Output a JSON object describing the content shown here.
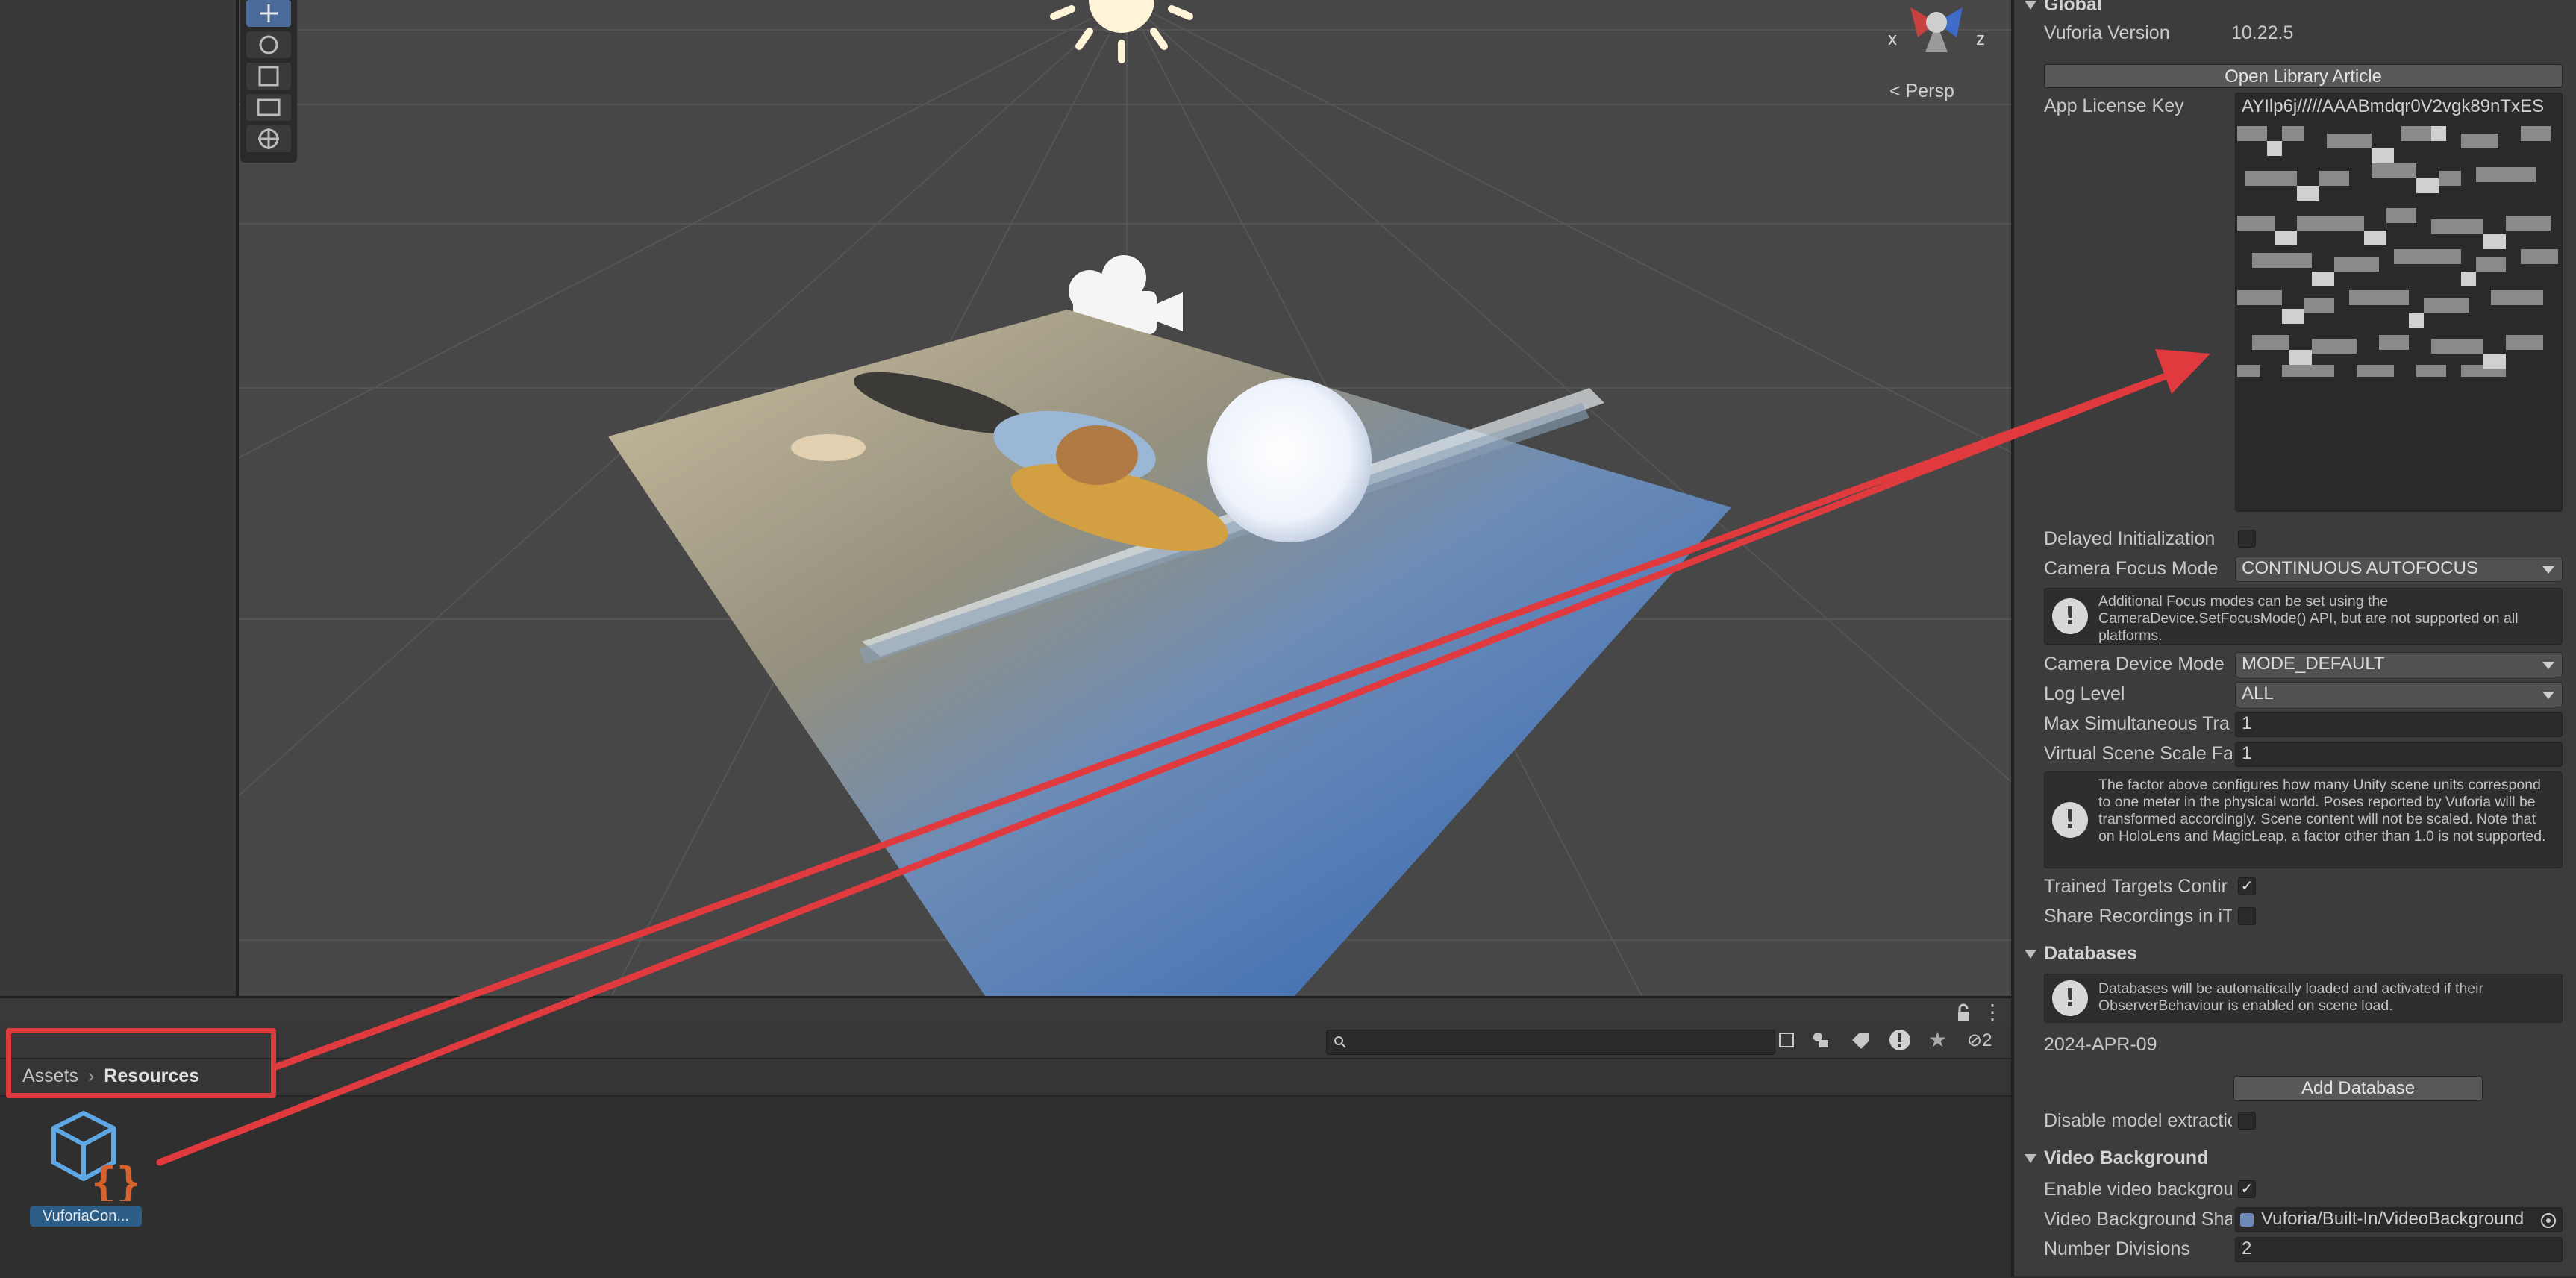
{
  "scene": {
    "gizmo_x": "x",
    "gizmo_z": "z",
    "persp_label": "Persp",
    "tools": [
      "move-tool-icon",
      "rotate-tool-icon",
      "scale-tool-icon",
      "rect-tool-icon",
      "transform-tool-icon"
    ]
  },
  "project": {
    "breadcrumb_root": "Assets",
    "breadcrumb_current": "Resources",
    "hidden_count": "2",
    "asset_label": "VuforiaCon...",
    "search_placeholder": ""
  },
  "inspector": {
    "global_header": "Global",
    "vuforia_version_label": "Vuforia Version",
    "vuforia_version_value": "10.22.5",
    "open_library_button": "Open Library Article",
    "app_license_label": "App License Key",
    "app_license_value": "AYIlp6j/////AAABmdqr0V2vgk89nTxES",
    "delayed_init_label": "Delayed Initialization",
    "camera_focus_label": "Camera Focus Mode",
    "camera_focus_value": "CONTINUOUS AUTOFOCUS",
    "focus_help": "Additional Focus modes can be set using the CameraDevice.SetFocusMode() API, but are not supported on all platforms.",
    "camera_device_label": "Camera Device Mode",
    "camera_device_value": "MODE_DEFAULT",
    "log_level_label": "Log Level",
    "log_level_value": "ALL",
    "max_tracked_label": "Max Simultaneous Tra",
    "max_tracked_value": "1",
    "virtual_scale_label": "Virtual Scene Scale Fa",
    "virtual_scale_value": "1",
    "scale_help": "The factor above configures how many Unity scene units correspond to one meter in the physical world. Poses reported by Vuforia will be transformed accordingly. Scene content will not be scaled. Note that on HoloLens and MagicLeap, a factor other than 1.0 is not supported.",
    "trained_targets_label": "Trained Targets Contir",
    "share_recordings_label": "Share Recordings in iT",
    "databases_header": "Databases",
    "databases_help": "Databases will be automatically loaded and activated if their ObserverBehaviour is enabled on scene load.",
    "database_name": "2024-APR-09",
    "add_database_button": "Add Database",
    "disable_model_label": "Disable model extractio",
    "video_bg_header": "Video Background",
    "enable_video_label": "Enable video backgrou",
    "video_shader_label": "Video Background Sha",
    "video_shader_value": "Vuforia/Built-In/VideoBackground",
    "num_divisions_label": "Number Divisions",
    "num_divisions_value": "2"
  },
  "colors": {
    "annotation_red": "#e03a3f",
    "scene_bg": "#474747",
    "inspector_bg": "#3c3c3c",
    "asset_icon_blue": "#5fa8e6",
    "asset_icon_orange": "#d7622d"
  }
}
